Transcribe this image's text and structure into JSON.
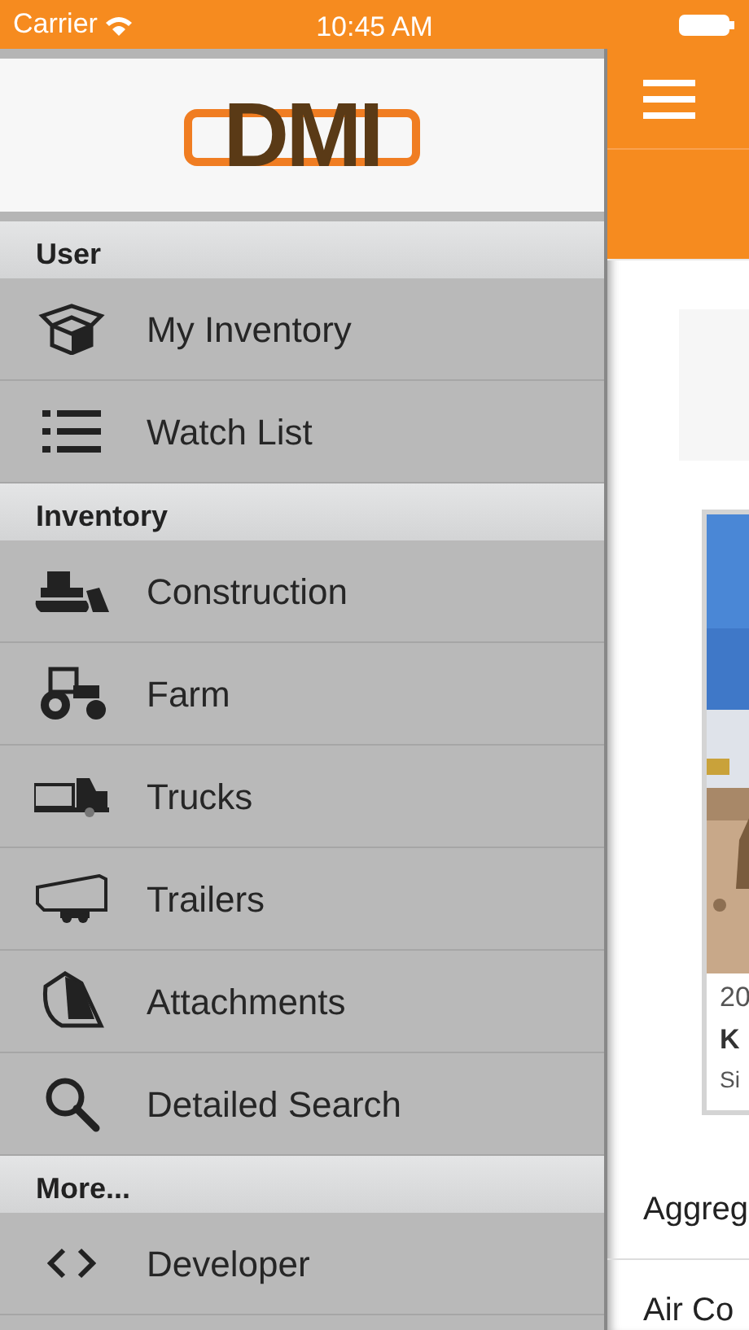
{
  "status_bar": {
    "carrier": "Carrier",
    "time": "10:45 AM"
  },
  "drawer": {
    "logo": "DMI",
    "sections": [
      {
        "title": "User",
        "items": [
          {
            "label": "My Inventory"
          },
          {
            "label": "Watch List"
          }
        ]
      },
      {
        "title": "Inventory",
        "items": [
          {
            "label": "Construction"
          },
          {
            "label": "Farm"
          },
          {
            "label": "Trucks"
          },
          {
            "label": "Trailers"
          },
          {
            "label": "Attachments"
          },
          {
            "label": "Detailed Search"
          }
        ]
      },
      {
        "title": "More...",
        "items": [
          {
            "label": "Developer"
          }
        ]
      }
    ]
  },
  "main": {
    "listing_card": {
      "kind": "picture",
      "year": "20",
      "title": "K",
      "location": "Si"
    },
    "categories": [
      "Aggreg",
      "Air Co"
    ]
  }
}
